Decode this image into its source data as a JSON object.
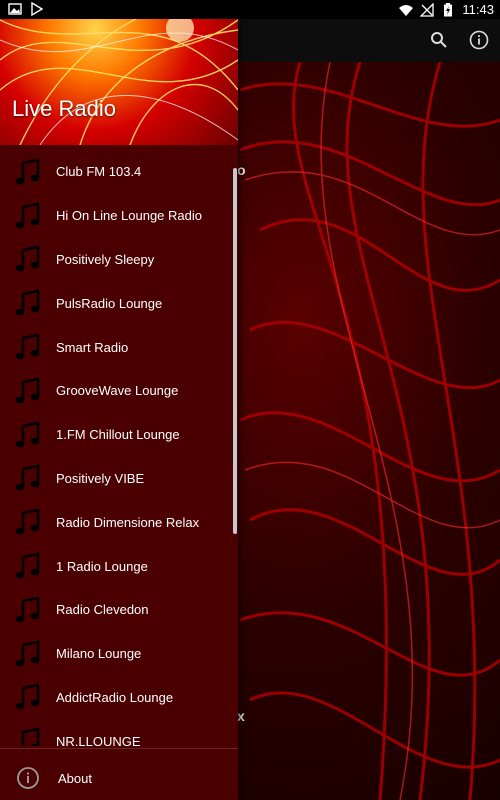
{
  "status_bar": {
    "time": "11:43",
    "icons": [
      "image-icon",
      "play-store-icon",
      "wifi-icon",
      "signal-off-icon",
      "battery-charging-icon"
    ]
  },
  "toolbar": {
    "actions": [
      "search-icon",
      "info-icon"
    ]
  },
  "drawer": {
    "title": "Live Radio",
    "stations": [
      {
        "label": "Club FM 103.4"
      },
      {
        "label": "Hi On Line Lounge Radio"
      },
      {
        "label": "Positively Sleepy"
      },
      {
        "label": "PulsRadio Lounge"
      },
      {
        "label": "Smart Radio"
      },
      {
        "label": "GrooveWave Lounge"
      },
      {
        "label": "1.FM Chillout Lounge"
      },
      {
        "label": "Positively VIBE"
      },
      {
        "label": "Radio Dimensione Relax"
      },
      {
        "label": "1 Radio Lounge"
      },
      {
        "label": "Radio Clevedon"
      },
      {
        "label": "Milano Lounge"
      },
      {
        "label": "AddictRadio Lounge"
      },
      {
        "label": "NR.LLOUNGE"
      }
    ],
    "about_label": "About"
  },
  "background": {
    "stray_o": "o",
    "stray_x": "x"
  },
  "colors": {
    "drawer_bg": "#4a0000",
    "accent_red": "#d40000"
  }
}
